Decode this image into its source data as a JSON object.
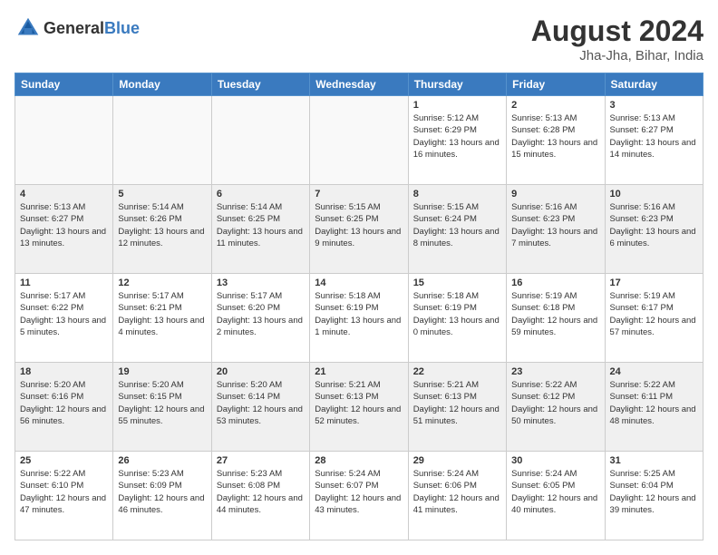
{
  "logo": {
    "text_general": "General",
    "text_blue": "Blue"
  },
  "header": {
    "month_year": "August 2024",
    "location": "Jha-Jha, Bihar, India"
  },
  "days_of_week": [
    "Sunday",
    "Monday",
    "Tuesday",
    "Wednesday",
    "Thursday",
    "Friday",
    "Saturday"
  ],
  "weeks": [
    {
      "days": [
        {
          "day": "",
          "empty": true
        },
        {
          "day": "",
          "empty": true
        },
        {
          "day": "",
          "empty": true
        },
        {
          "day": "",
          "empty": true
        },
        {
          "day": "1",
          "sunrise": "Sunrise: 5:12 AM",
          "sunset": "Sunset: 6:29 PM",
          "daylight": "Daylight: 13 hours and 16 minutes."
        },
        {
          "day": "2",
          "sunrise": "Sunrise: 5:13 AM",
          "sunset": "Sunset: 6:28 PM",
          "daylight": "Daylight: 13 hours and 15 minutes."
        },
        {
          "day": "3",
          "sunrise": "Sunrise: 5:13 AM",
          "sunset": "Sunset: 6:27 PM",
          "daylight": "Daylight: 13 hours and 14 minutes."
        }
      ]
    },
    {
      "days": [
        {
          "day": "4",
          "sunrise": "Sunrise: 5:13 AM",
          "sunset": "Sunset: 6:27 PM",
          "daylight": "Daylight: 13 hours and 13 minutes."
        },
        {
          "day": "5",
          "sunrise": "Sunrise: 5:14 AM",
          "sunset": "Sunset: 6:26 PM",
          "daylight": "Daylight: 13 hours and 12 minutes."
        },
        {
          "day": "6",
          "sunrise": "Sunrise: 5:14 AM",
          "sunset": "Sunset: 6:25 PM",
          "daylight": "Daylight: 13 hours and 11 minutes."
        },
        {
          "day": "7",
          "sunrise": "Sunrise: 5:15 AM",
          "sunset": "Sunset: 6:25 PM",
          "daylight": "Daylight: 13 hours and 9 minutes."
        },
        {
          "day": "8",
          "sunrise": "Sunrise: 5:15 AM",
          "sunset": "Sunset: 6:24 PM",
          "daylight": "Daylight: 13 hours and 8 minutes."
        },
        {
          "day": "9",
          "sunrise": "Sunrise: 5:16 AM",
          "sunset": "Sunset: 6:23 PM",
          "daylight": "Daylight: 13 hours and 7 minutes."
        },
        {
          "day": "10",
          "sunrise": "Sunrise: 5:16 AM",
          "sunset": "Sunset: 6:23 PM",
          "daylight": "Daylight: 13 hours and 6 minutes."
        }
      ]
    },
    {
      "days": [
        {
          "day": "11",
          "sunrise": "Sunrise: 5:17 AM",
          "sunset": "Sunset: 6:22 PM",
          "daylight": "Daylight: 13 hours and 5 minutes."
        },
        {
          "day": "12",
          "sunrise": "Sunrise: 5:17 AM",
          "sunset": "Sunset: 6:21 PM",
          "daylight": "Daylight: 13 hours and 4 minutes."
        },
        {
          "day": "13",
          "sunrise": "Sunrise: 5:17 AM",
          "sunset": "Sunset: 6:20 PM",
          "daylight": "Daylight: 13 hours and 2 minutes."
        },
        {
          "day": "14",
          "sunrise": "Sunrise: 5:18 AM",
          "sunset": "Sunset: 6:19 PM",
          "daylight": "Daylight: 13 hours and 1 minute."
        },
        {
          "day": "15",
          "sunrise": "Sunrise: 5:18 AM",
          "sunset": "Sunset: 6:19 PM",
          "daylight": "Daylight: 13 hours and 0 minutes."
        },
        {
          "day": "16",
          "sunrise": "Sunrise: 5:19 AM",
          "sunset": "Sunset: 6:18 PM",
          "daylight": "Daylight: 12 hours and 59 minutes."
        },
        {
          "day": "17",
          "sunrise": "Sunrise: 5:19 AM",
          "sunset": "Sunset: 6:17 PM",
          "daylight": "Daylight: 12 hours and 57 minutes."
        }
      ]
    },
    {
      "days": [
        {
          "day": "18",
          "sunrise": "Sunrise: 5:20 AM",
          "sunset": "Sunset: 6:16 PM",
          "daylight": "Daylight: 12 hours and 56 minutes."
        },
        {
          "day": "19",
          "sunrise": "Sunrise: 5:20 AM",
          "sunset": "Sunset: 6:15 PM",
          "daylight": "Daylight: 12 hours and 55 minutes."
        },
        {
          "day": "20",
          "sunrise": "Sunrise: 5:20 AM",
          "sunset": "Sunset: 6:14 PM",
          "daylight": "Daylight: 12 hours and 53 minutes."
        },
        {
          "day": "21",
          "sunrise": "Sunrise: 5:21 AM",
          "sunset": "Sunset: 6:13 PM",
          "daylight": "Daylight: 12 hours and 52 minutes."
        },
        {
          "day": "22",
          "sunrise": "Sunrise: 5:21 AM",
          "sunset": "Sunset: 6:13 PM",
          "daylight": "Daylight: 12 hours and 51 minutes."
        },
        {
          "day": "23",
          "sunrise": "Sunrise: 5:22 AM",
          "sunset": "Sunset: 6:12 PM",
          "daylight": "Daylight: 12 hours and 50 minutes."
        },
        {
          "day": "24",
          "sunrise": "Sunrise: 5:22 AM",
          "sunset": "Sunset: 6:11 PM",
          "daylight": "Daylight: 12 hours and 48 minutes."
        }
      ]
    },
    {
      "days": [
        {
          "day": "25",
          "sunrise": "Sunrise: 5:22 AM",
          "sunset": "Sunset: 6:10 PM",
          "daylight": "Daylight: 12 hours and 47 minutes."
        },
        {
          "day": "26",
          "sunrise": "Sunrise: 5:23 AM",
          "sunset": "Sunset: 6:09 PM",
          "daylight": "Daylight: 12 hours and 46 minutes."
        },
        {
          "day": "27",
          "sunrise": "Sunrise: 5:23 AM",
          "sunset": "Sunset: 6:08 PM",
          "daylight": "Daylight: 12 hours and 44 minutes."
        },
        {
          "day": "28",
          "sunrise": "Sunrise: 5:24 AM",
          "sunset": "Sunset: 6:07 PM",
          "daylight": "Daylight: 12 hours and 43 minutes."
        },
        {
          "day": "29",
          "sunrise": "Sunrise: 5:24 AM",
          "sunset": "Sunset: 6:06 PM",
          "daylight": "Daylight: 12 hours and 41 minutes."
        },
        {
          "day": "30",
          "sunrise": "Sunrise: 5:24 AM",
          "sunset": "Sunset: 6:05 PM",
          "daylight": "Daylight: 12 hours and 40 minutes."
        },
        {
          "day": "31",
          "sunrise": "Sunrise: 5:25 AM",
          "sunset": "Sunset: 6:04 PM",
          "daylight": "Daylight: 12 hours and 39 minutes."
        }
      ]
    }
  ]
}
